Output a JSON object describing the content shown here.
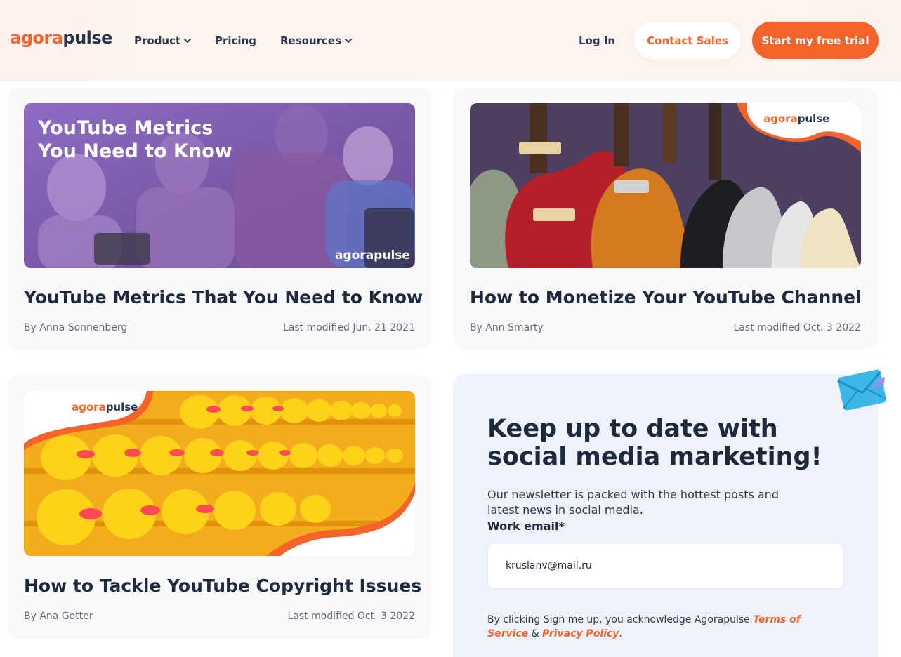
{
  "header": {
    "logo_part1": "agora",
    "logo_part2": "pulse",
    "nav": [
      {
        "label": "Product",
        "has_dropdown": true
      },
      {
        "label": "Pricing",
        "has_dropdown": false
      },
      {
        "label": "Resources",
        "has_dropdown": true
      }
    ],
    "login_label": "Log In",
    "contact_label": "Contact Sales",
    "trial_label": "Start my free trial"
  },
  "articles": [
    {
      "title": "YouTube Metrics That You Need to Know",
      "author": "By Anna Sonnenberg",
      "date": "Last modified Jun. 21 2021",
      "image_overlay_line1": "YouTube Metrics",
      "image_overlay_line2": "You Need to Know",
      "image_logo": "agorapulse"
    },
    {
      "title": "How to Monetize Your YouTube Channel",
      "author": "By Ann Smarty",
      "date": "Last modified Oct. 3 2022",
      "image_logo_part1": "agora",
      "image_logo_part2": "pulse"
    },
    {
      "title": "How to Tackle YouTube Copyright Issues",
      "author": "By Ana Gotter",
      "date": "Last modified Oct. 3 2022",
      "image_logo_part1": "agora",
      "image_logo_part2": "pulse"
    }
  ],
  "newsletter": {
    "title": "Keep up to date with social media marketing!",
    "description": "Our newsletter is packed with the hottest posts and latest news in social media.",
    "email_label": "Work email*",
    "email_value": "kruslanv@mail.ru",
    "legal_prefix": "By clicking Sign me up, you acknowledge Agorapulse ",
    "terms_label": "Terms of Service",
    "legal_and": " & ",
    "privacy_label": "Privacy Policy",
    "legal_suffix": "."
  },
  "colors": {
    "brand_orange": "#f4632a",
    "navy": "#1d2a3d",
    "card_bg": "#f9f9fb",
    "newsletter_bg": "#eef3fb"
  },
  "icons": [
    "chevron-down-icon",
    "envelope-icon"
  ]
}
